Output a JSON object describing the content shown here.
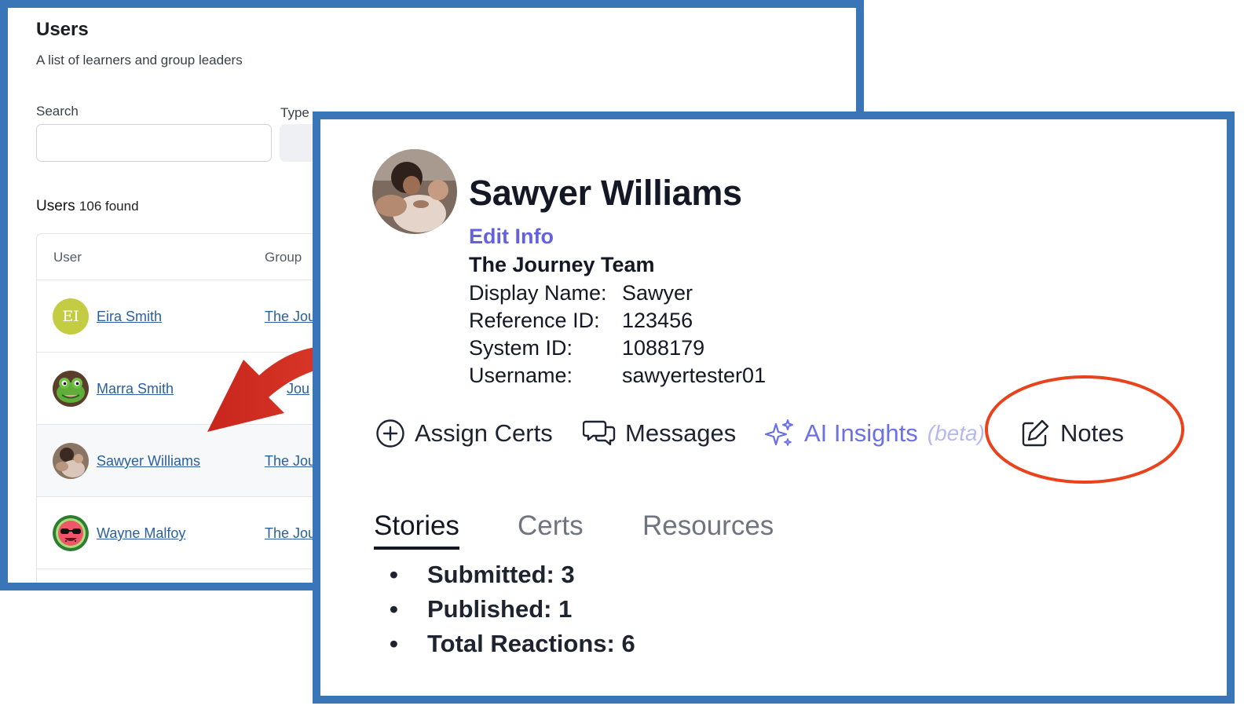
{
  "users_page": {
    "title": "Users",
    "subtitle": "A list of learners and group leaders",
    "filters": {
      "search_label": "Search",
      "search_value": "",
      "type_label": "Type"
    },
    "count_label": "Users",
    "count_text": "106 found",
    "table": {
      "headers": [
        "User",
        "Group"
      ],
      "rows": [
        {
          "name": "Eira Smith",
          "group": "The Jou",
          "avatar_initials": "EI",
          "avatar_color": "#c4cc44",
          "selected": false
        },
        {
          "name": "Marra Smith",
          "group": "Jou",
          "avatar_icon": "frog-avatar",
          "selected": false
        },
        {
          "name": "Sawyer Williams",
          "group": "The Jou",
          "avatar_icon": "photo-avatar",
          "selected": true
        },
        {
          "name": "Wayne Malfoy",
          "group": "The Jou",
          "avatar_icon": "watermelon-avatar",
          "selected": false
        }
      ]
    }
  },
  "annotation": {
    "arrow_color": "#d93025",
    "highlight_color": "#e8431c",
    "frame_color": "#3a75b8"
  },
  "profile": {
    "name": "Sawyer Williams",
    "edit_label": "Edit Info",
    "team": "The Journey Team",
    "fields": [
      {
        "label": "Display Name:",
        "value": "Sawyer"
      },
      {
        "label": "Reference ID:",
        "value": "123456"
      },
      {
        "label": "System ID:",
        "value": "1088179"
      },
      {
        "label": "Username:",
        "value": "sawyertester01"
      }
    ],
    "actions": {
      "assign_certs": "Assign Certs",
      "messages": "Messages",
      "ai_insights": "AI Insights",
      "ai_beta": "(beta)",
      "notes": "Notes"
    },
    "tabs": [
      "Stories",
      "Certs",
      "Resources"
    ],
    "active_tab": "Stories",
    "stats": [
      "Submitted: 3",
      "Published: 1",
      "Total Reactions: 6"
    ],
    "accent_color": "#6461de"
  }
}
